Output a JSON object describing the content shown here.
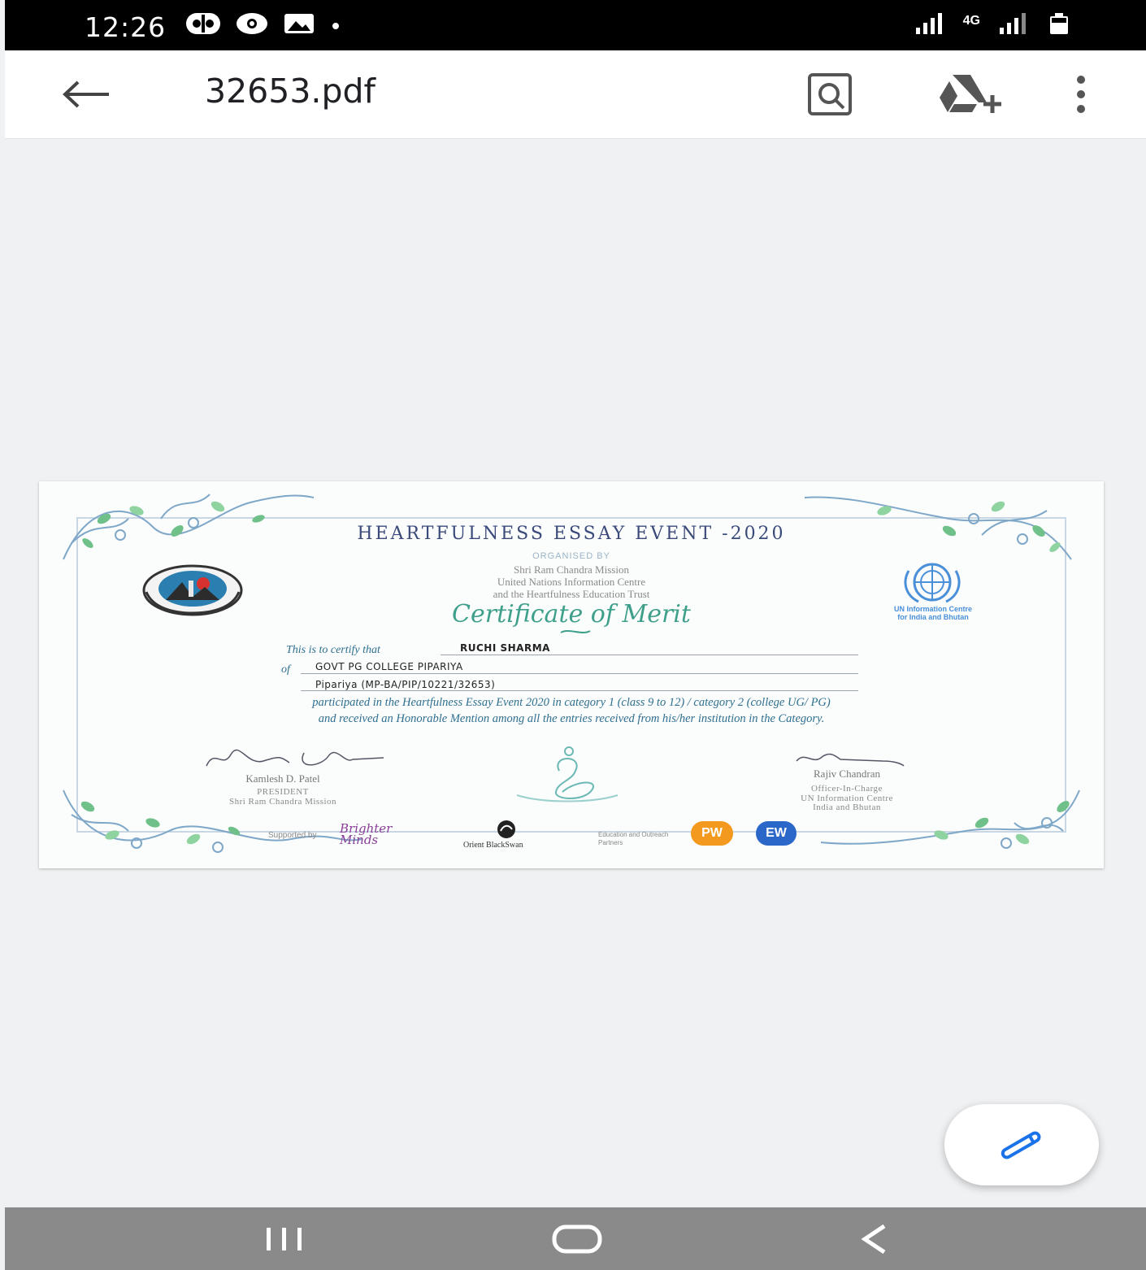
{
  "status_bar": {
    "time": "12:26",
    "network": "4G"
  },
  "app_bar": {
    "title": "32653.pdf"
  },
  "certificate": {
    "title": "HEARTFULNESS ESSAY EVENT -2020",
    "organised_by": "ORGANISED BY",
    "organisers": [
      "Shri Ram Chandra Mission",
      "United Nations Information Centre",
      "and the Heartfulness Education Trust"
    ],
    "heading": "Certificate of Merit",
    "un_logo_caption": [
      "UN Information Centre",
      "for India and Bhutan"
    ],
    "certify_label": "This is to certify that",
    "name": "RUCHI SHARMA",
    "of_label": "of",
    "college": "GOVT PG COLLEGE PIPARIYA",
    "reference": "Pipariya (MP-BA/PIP/10221/32653)",
    "body_line1": "participated in the Heartfulness Essay Event 2020 in category 1 (class 9 to 12) / category 2 (college UG/ PG)",
    "body_line2": "and received an Honorable Mention among all the entries received from his/her institution in the Category.",
    "signatory_left": {
      "name": "Kamlesh D. Patel",
      "role": "PRESIDENT",
      "org": "Shri Ram Chandra Mission"
    },
    "signatory_right": {
      "name": "Rajiv Chandran",
      "role": "Officer-In-Charge",
      "org_line1": "UN Information Centre",
      "org_line2": "India and Bhutan"
    },
    "supported_by": "Supported by",
    "sponsors": {
      "brighter_minds": "Brighter Minds",
      "orient": "Orient BlackSwan",
      "partners_label": "Education and Outreach Partners",
      "pw": "PW",
      "ew": "EW"
    }
  },
  "colors": {
    "accent_blue": "#2e6f90",
    "teal": "#3e9f8a",
    "fab_pencil": "#1a73e8"
  }
}
